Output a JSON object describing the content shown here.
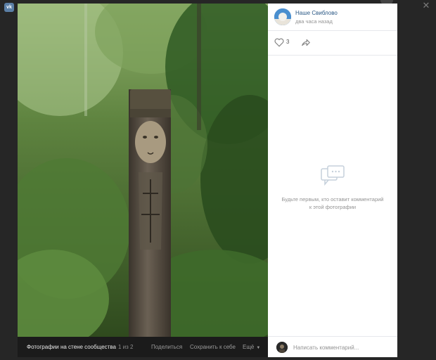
{
  "app": {
    "logo_text": "vk"
  },
  "post": {
    "author": "Наше Свиблово",
    "time": "два часа назад",
    "likes": "3"
  },
  "photo_footer": {
    "title": "Фотографии на стене сообщества",
    "counter": "1 из 2",
    "share": "Поделиться",
    "save": "Сохранить к себе",
    "more": "Ещё"
  },
  "comments": {
    "empty_text": "Будьте первым, кто оставит комментарий к этой фотографии",
    "placeholder": "Написать комментарий..."
  },
  "colors": {
    "link": "#2a5885",
    "muted": "#939393",
    "panel_bg": "#ffffff",
    "backdrop": "#262626"
  }
}
